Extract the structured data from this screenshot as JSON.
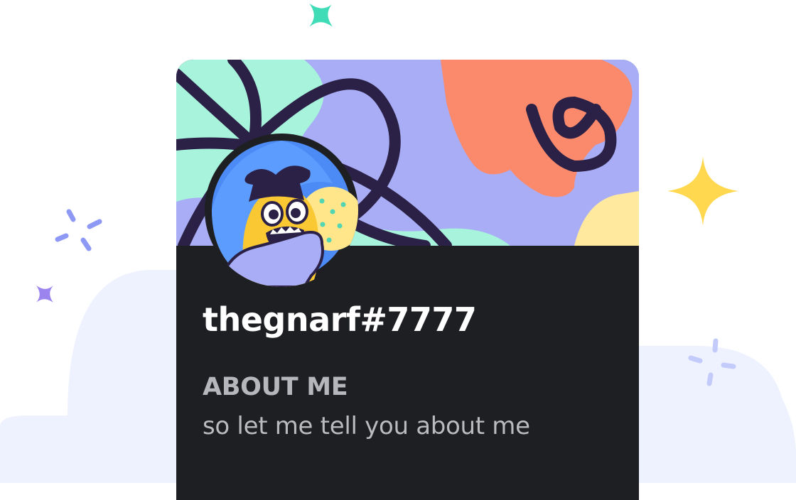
{
  "colors": {
    "background_cloud": "#eef2fe",
    "card_background": "#1e1f22",
    "username_text": "#ffffff",
    "heading_text": "#b5b7bc",
    "body_text": "#b9bbbe",
    "sparkle_teal": "#3fdcb7",
    "sparkle_yellow": "#ffd84f",
    "sparkle_purple": "#9b84ee",
    "sparkle_blue": "#8e99f5",
    "sparkle_light_blue": "#c3cbfb",
    "banner_mint": "#a7f3dc",
    "banner_lavender": "#a9adf5",
    "banner_coral": "#fb8a6c",
    "banner_dark_lines": "#2b2147"
  },
  "icons": {
    "teal_sparkle": "four-point-star-icon",
    "yellow_sparkle": "four-point-star-icon",
    "purple_sparkle": "four-point-star-icon",
    "blue_sparkle_burst": "sparkle-burst-icon",
    "light_blue_sparkle_burst": "sparkle-burst-icon"
  },
  "profile": {
    "username": "thegnarf#7777",
    "about_heading": "ABOUT ME",
    "about_text": "so let me tell you about me"
  }
}
